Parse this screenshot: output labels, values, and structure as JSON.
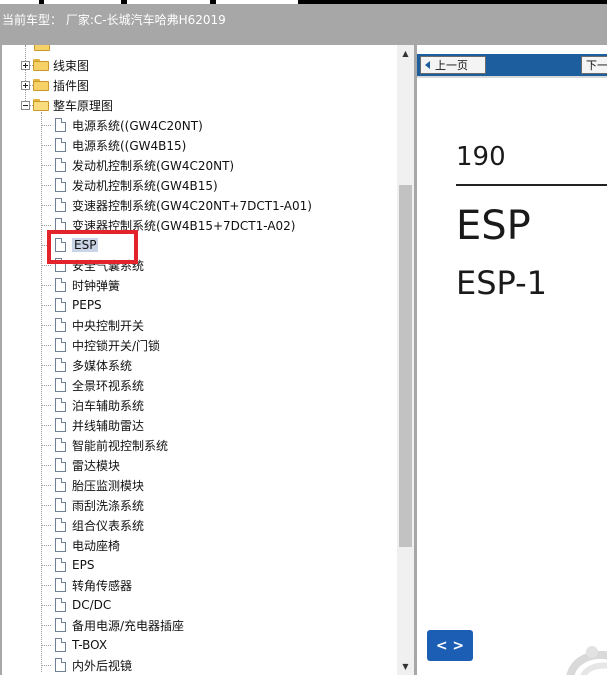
{
  "header": {
    "vehicle_label": "当前车型： 厂家:C-长城汽车哈弗H62019"
  },
  "tree": {
    "folders": [
      {
        "label": "线束图",
        "state": "collapsed"
      },
      {
        "label": "插件图",
        "state": "collapsed"
      },
      {
        "label": "整车原理图",
        "state": "expanded"
      }
    ],
    "items": [
      "电源系统((GW4C20NT)",
      "电源系统((GW4B15)",
      "发动机控制系统(GW4C20NT)",
      "发动机控制系统(GW4B15)",
      "变速器控制系统(GW4C20NT+7DCT1-A01)",
      "变速器控制系统(GW4B15+7DCT1-A02)",
      "ESP",
      "安全气囊系统",
      "时钟弹簧",
      "PEPS",
      "中央控制开关",
      "中控锁开关/门锁",
      "多媒体系统",
      "全景环视系统",
      "泊车辅助系统",
      "并线辅助雷达",
      "智能前视控制系统",
      "雷达模块",
      "胎压监测模块",
      "雨刮洗涤系统",
      "组合仪表系统",
      "电动座椅",
      "EPS",
      "转角传感器",
      "DC/DC",
      "备用电源/充电器插座",
      "T-BOX",
      "内外后视镜"
    ],
    "selected_item": "ESP"
  },
  "viewer": {
    "prev_button": "上一页",
    "next_button": "下一",
    "page_number": "190",
    "title": "ESP",
    "subtitle": "ESP-1",
    "nav_button": "< >"
  },
  "colors": {
    "titlebar": "#a7a7a7",
    "toolbar": "#1d5e9e",
    "highlight_box": "#e4242c",
    "nav_button": "#1d5eb5"
  }
}
